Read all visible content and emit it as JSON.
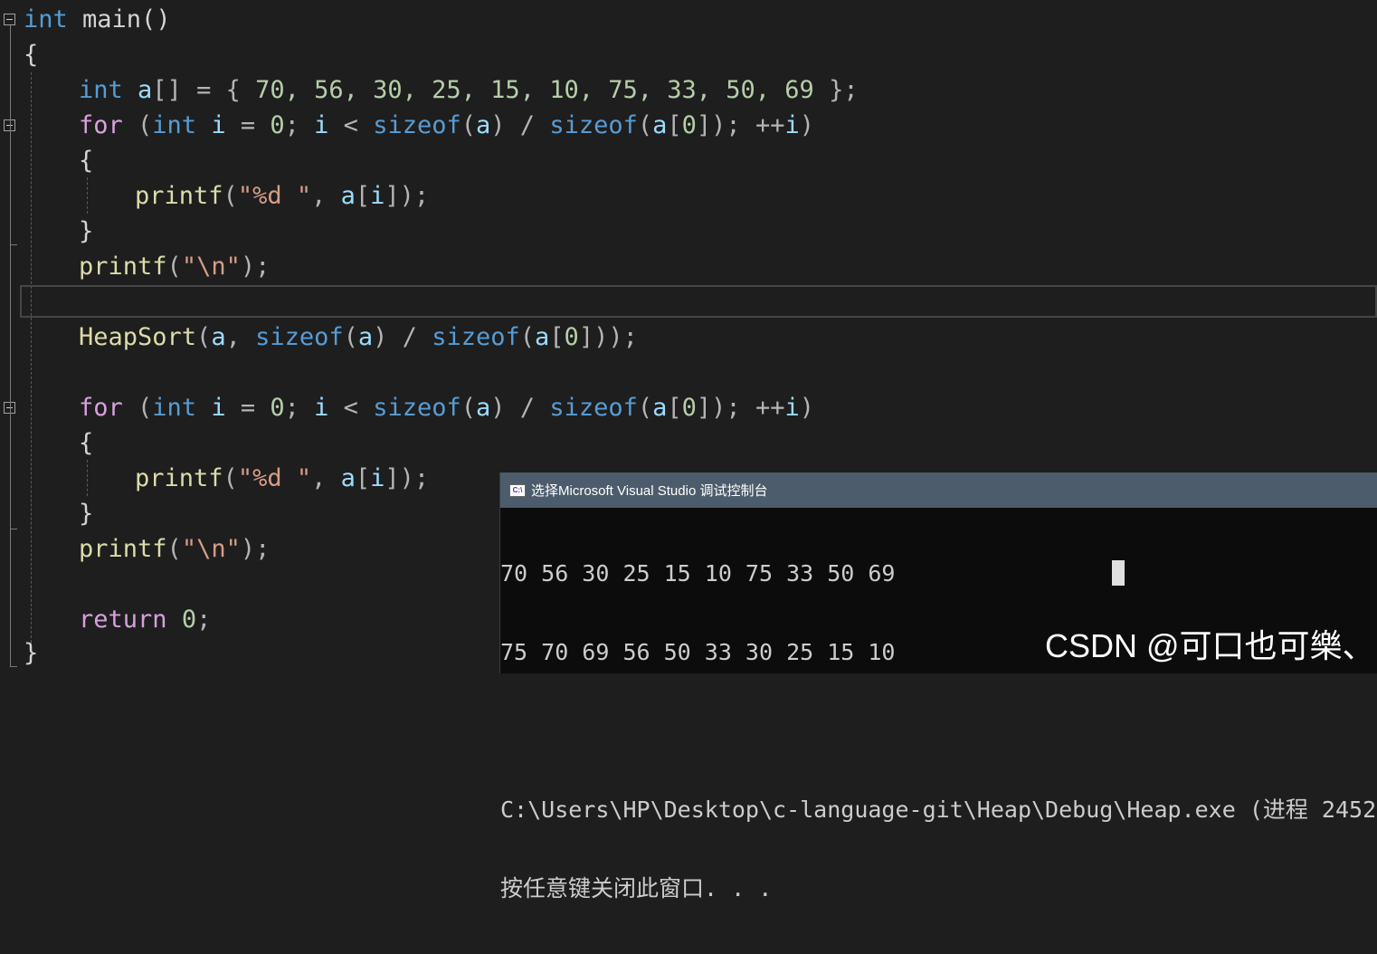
{
  "editor": {
    "lines": {
      "l1": {
        "kw": "int",
        "rest": " main()"
      },
      "l2": {
        "brace": "{"
      },
      "l3": {
        "kw": "int",
        "var": " a",
        "rest": "[] = { ",
        "nums": "70, 56, 30, 25, 15, 10, 75, 33, 50, 69",
        "tail": " };"
      },
      "l4": {
        "kw2": "for",
        "p1": " (",
        "kw": "int",
        "v1": " i",
        "p2": " = ",
        "n1": "0",
        "p3": "; ",
        "v2": "i",
        "p4": " < ",
        "f1": "sizeof",
        "p5": "(",
        "v3": "a",
        "p6": ") / ",
        "f2": "sizeof",
        "p7": "(",
        "v4": "a",
        "p8": "[",
        "n2": "0",
        "p9": "]); ++",
        "v5": "i",
        "p10": ")"
      },
      "l5": {
        "brace": "{"
      },
      "l6": {
        "fn": "printf",
        "p1": "(",
        "str": "\"%d \"",
        "p2": ", ",
        "var": "a",
        "p3": "[",
        "v2": "i",
        "p4": "]);"
      },
      "l7": {
        "brace": "}"
      },
      "l8": {
        "fn": "printf",
        "p1": "(",
        "str": "\"\\n\"",
        "p2": ");"
      },
      "l10": {
        "fn": "HeapSort",
        "p1": "(",
        "v1": "a",
        "p2": ", ",
        "f1": "sizeof",
        "p3": "(",
        "v2": "a",
        "p4": ") / ",
        "f2": "sizeof",
        "p5": "(",
        "v3": "a",
        "p6": "[",
        "n1": "0",
        "p7": "]));"
      },
      "l12": {
        "kw2": "for",
        "p1": " (",
        "kw": "int",
        "v1": " i",
        "p2": " = ",
        "n1": "0",
        "p3": "; ",
        "v2": "i",
        "p4": " < ",
        "f1": "sizeof",
        "p5": "(",
        "v3": "a",
        "p6": ") / ",
        "f2": "sizeof",
        "p7": "(",
        "v4": "a",
        "p8": "[",
        "n2": "0",
        "p9": "]); ++",
        "v5": "i",
        "p10": ")"
      },
      "l13": {
        "brace": "{"
      },
      "l14": {
        "fn": "printf",
        "p1": "(",
        "str": "\"%d \"",
        "p2": ", ",
        "var": "a",
        "p3": "[",
        "v2": "i",
        "p4": "]);"
      },
      "l15": {
        "brace": "}"
      },
      "l16": {
        "fn": "printf",
        "p1": "(",
        "str": "\"\\n\"",
        "p2": ");"
      },
      "l18": {
        "kw2": "return",
        "sp": " ",
        "num": "0",
        "p": ";"
      },
      "l19": {
        "brace": "}"
      }
    }
  },
  "console": {
    "title": "选择Microsoft Visual Studio 调试控制台",
    "icon": "console-app-icon",
    "output_line1": "70 56 30 25 15 10 75 33 50 69",
    "output_line2": "75 70 69 56 50 33 30 25 15 10",
    "path_line": "C:\\Users\\HP\\Desktop\\c-language-git\\Heap\\Debug\\Heap.exe (进程 2452",
    "close_prompt": "按任意键关闭此窗口. . ."
  },
  "watermark": {
    "text": "CSDN @可口也可樂、"
  },
  "colors": {
    "editor_bg": "#1e1e1e",
    "keyword": "#569cd6",
    "control_keyword": "#d8a0df",
    "function": "#dcdcaa",
    "variable": "#9cdcfe",
    "number": "#b5cea8",
    "string": "#d69d85",
    "console_title_bg": "#4c5c6c",
    "console_bg": "#0c0c0c"
  }
}
